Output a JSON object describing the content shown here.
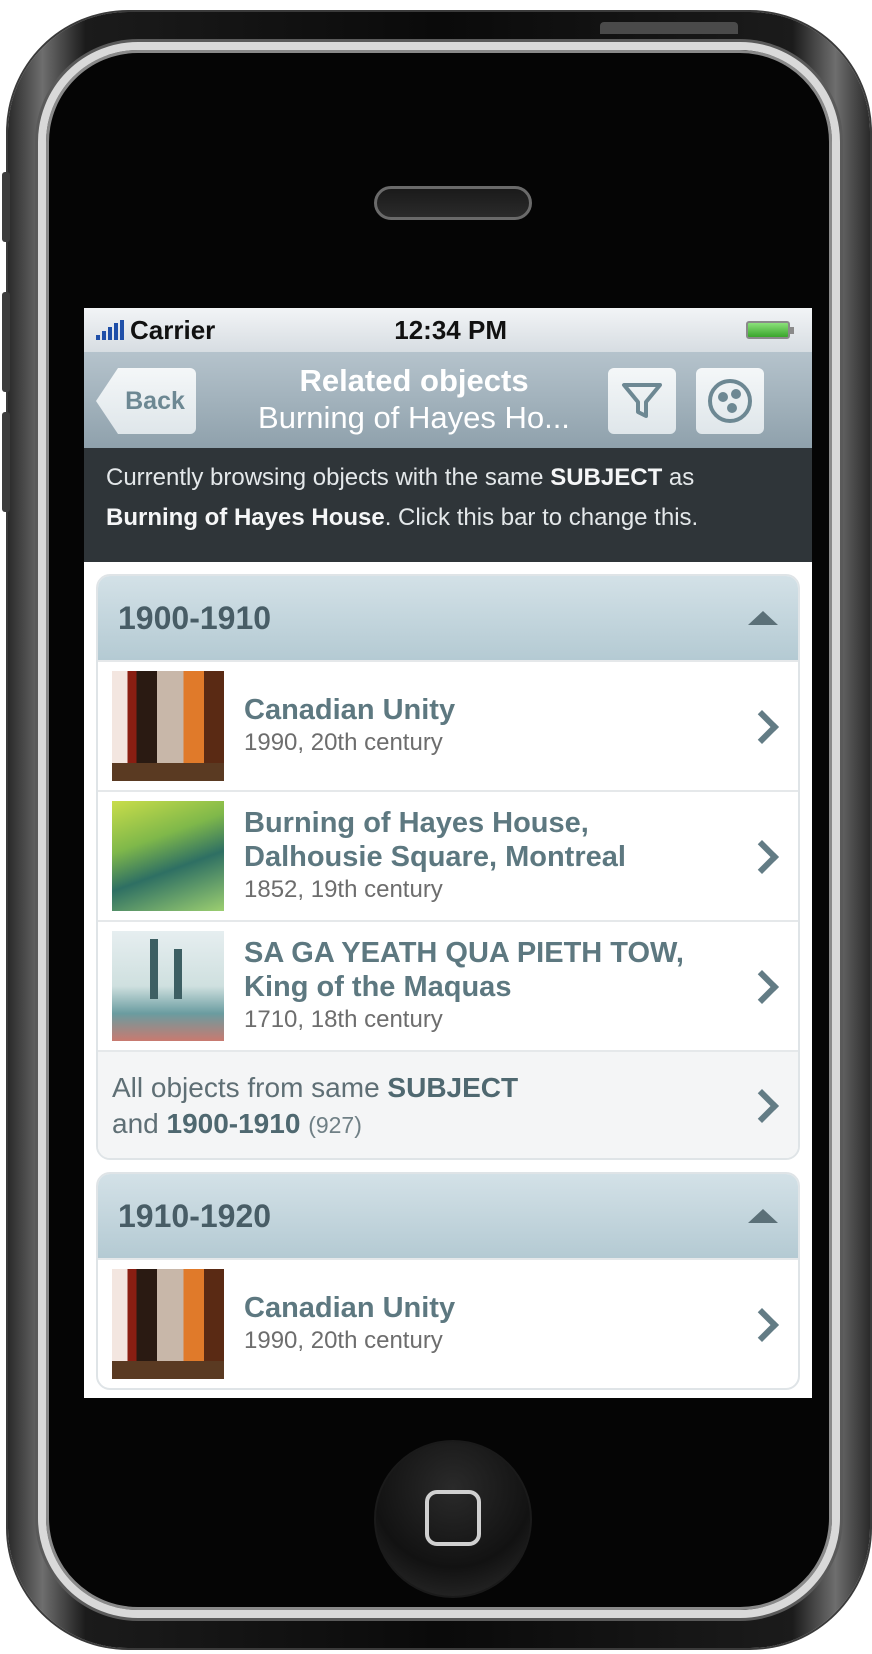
{
  "status_bar": {
    "carrier": "Carrier",
    "time": "12:34 PM"
  },
  "nav": {
    "back_label": "Back",
    "title": "Related objects",
    "subtitle": "Burning of Hayes Ho..."
  },
  "info_bar": {
    "prefix": "Currently browsing objects with the same",
    "field": "SUBJECT",
    "middle": "as",
    "value": "Burning of Hayes House",
    "suffix": ". Click this bar to change this."
  },
  "groups": [
    {
      "label": "1900-1910",
      "items": [
        {
          "title": "Canadian Unity",
          "meta": "1990, 20th century"
        },
        {
          "title": "Burning of Hayes House, Dalhousie Square, Montreal",
          "meta": "1852, 19th century"
        },
        {
          "title": "SA GA YEATH QUA PIETH TOW, King of the Maquas",
          "meta": "1710, 18th century"
        }
      ],
      "all": {
        "prefix": "All objects from same",
        "field": "SUBJECT",
        "and": "and",
        "range": "1900-1910",
        "count": "(927)"
      }
    },
    {
      "label": "1910-1920",
      "items": [
        {
          "title": "Canadian Unity",
          "meta": "1990, 20th century"
        }
      ]
    }
  ],
  "icons": {
    "filter": "filter-icon",
    "browse": "circle-dots-icon",
    "expand": "triangle-up-icon",
    "row": "chevron-right-icon"
  },
  "colors": {
    "nav_bar": "#a3b4bd",
    "group_header": "#c3d5dc",
    "info_bar": "#2f3539",
    "item_title": "#5d7880"
  }
}
